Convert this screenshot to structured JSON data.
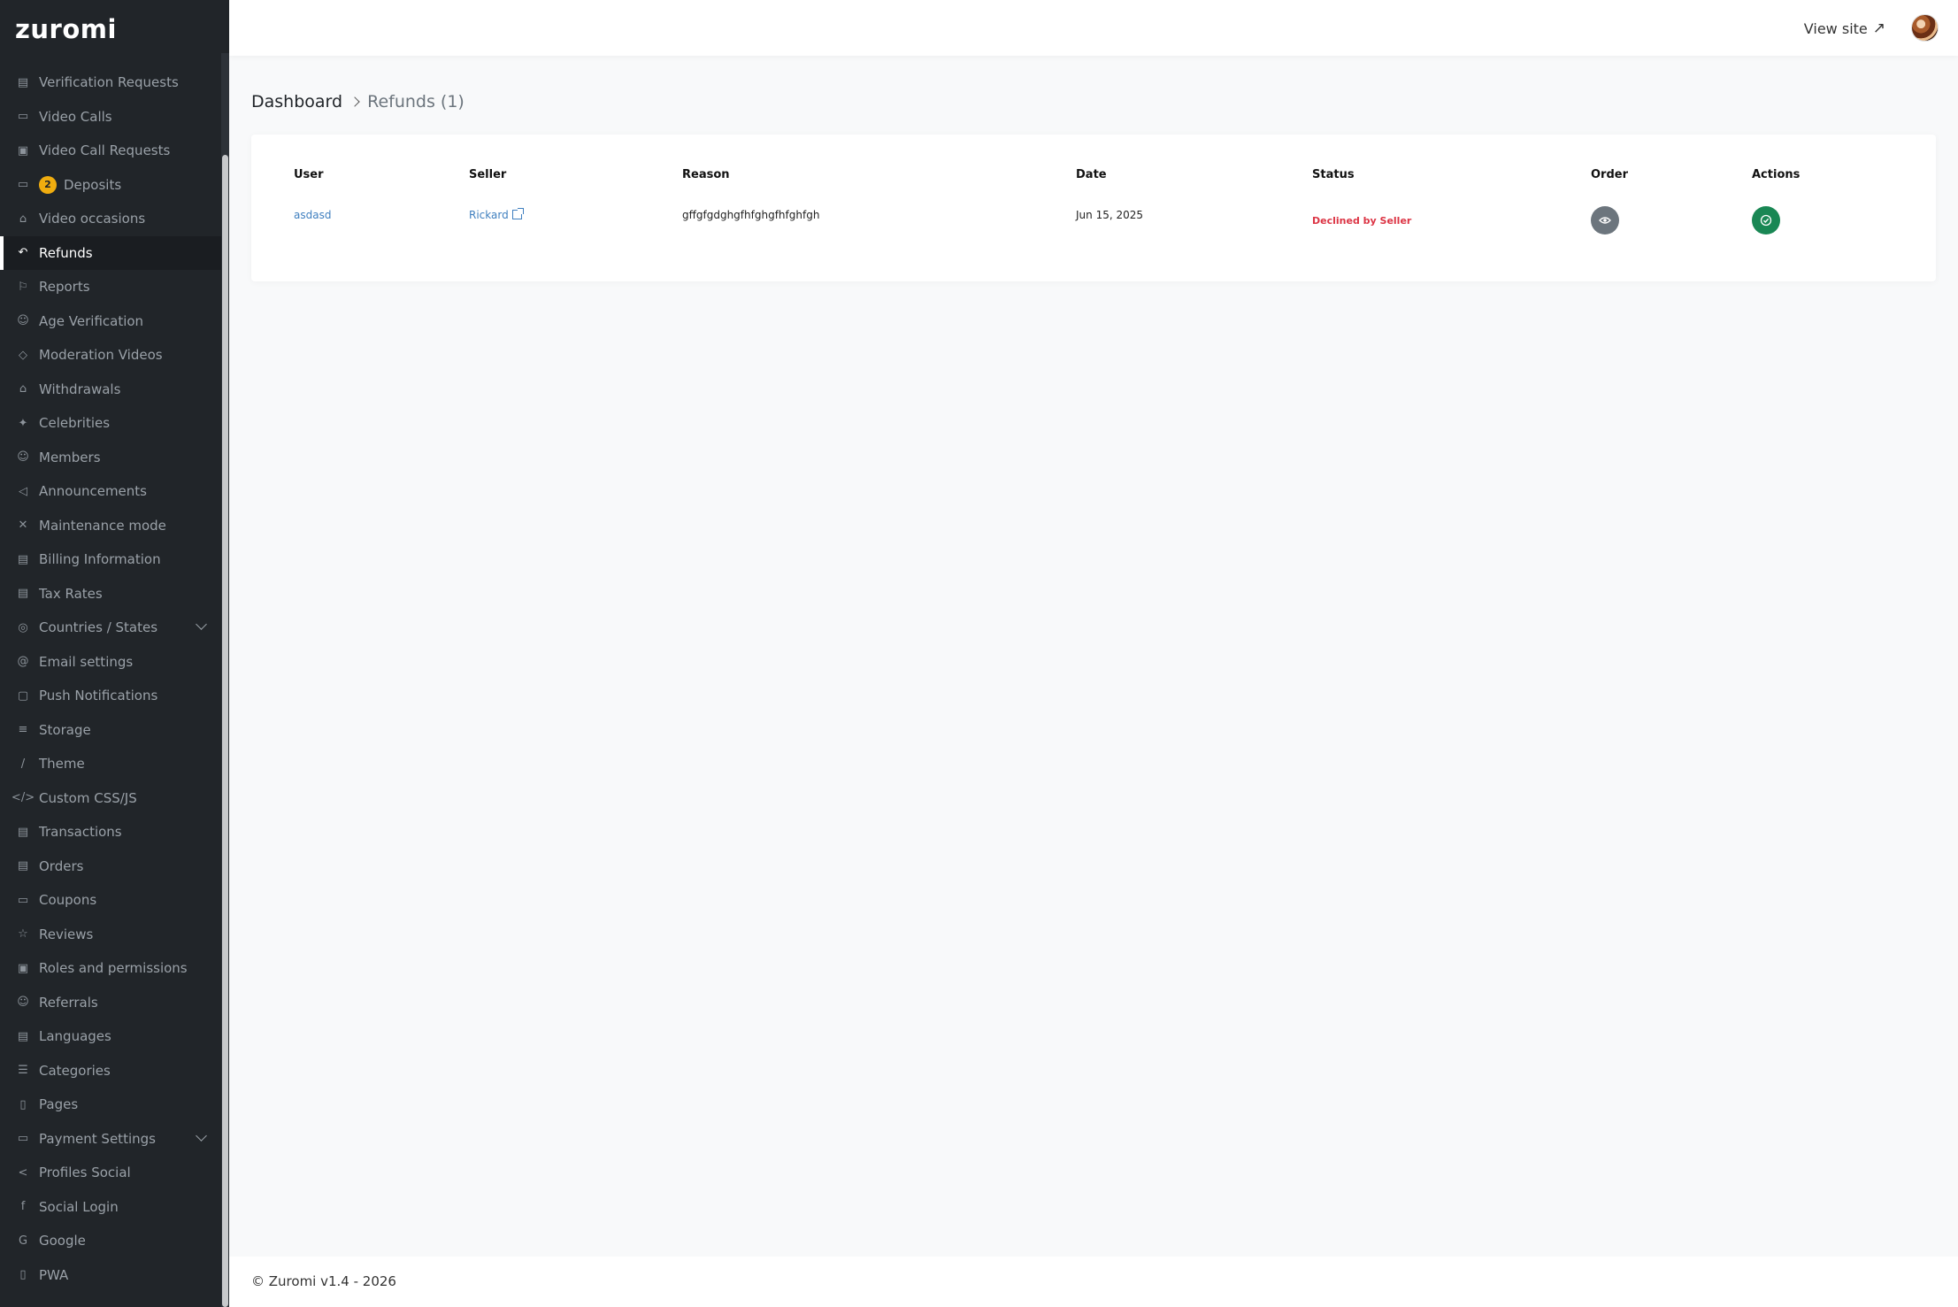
{
  "brand": {
    "name": "zuromi"
  },
  "header": {
    "view_site_label": "View site",
    "view_site_icon": "arrow-up-right-icon"
  },
  "sidebar": {
    "items": [
      {
        "label": "Verification Requests",
        "icon": "id-card-icon",
        "glyph": "▤"
      },
      {
        "label": "Video Calls",
        "icon": "video-camera-icon",
        "glyph": "▭"
      },
      {
        "label": "Video Call Requests",
        "icon": "video-request-icon",
        "glyph": "▣"
      },
      {
        "label": "Deposits",
        "icon": "cash-icon",
        "glyph": "▭",
        "badge": "2"
      },
      {
        "label": "Video occasions",
        "icon": "shop-icon",
        "glyph": "⌂"
      },
      {
        "label": "Refunds",
        "icon": "refund-icon",
        "glyph": "↶",
        "active": true
      },
      {
        "label": "Reports",
        "icon": "flag-icon",
        "glyph": "⚐"
      },
      {
        "label": "Age Verification",
        "icon": "person-badge-icon",
        "glyph": "☺"
      },
      {
        "label": "Moderation Videos",
        "icon": "shield-icon",
        "glyph": "◇"
      },
      {
        "label": "Withdrawals",
        "icon": "bank-icon",
        "glyph": "⌂"
      },
      {
        "label": "Celebrities",
        "icon": "stars-icon",
        "glyph": "✦"
      },
      {
        "label": "Members",
        "icon": "people-icon",
        "glyph": "☺"
      },
      {
        "label": "Announcements",
        "icon": "megaphone-icon",
        "glyph": "◁"
      },
      {
        "label": "Maintenance mode",
        "icon": "tools-icon",
        "glyph": "✕"
      },
      {
        "label": "Billing Information",
        "icon": "receipt-icon",
        "glyph": "▤"
      },
      {
        "label": "Tax Rates",
        "icon": "receipt-icon",
        "glyph": "▤"
      },
      {
        "label": "Countries / States",
        "icon": "globe-icon",
        "glyph": "◎",
        "expandable": true
      },
      {
        "label": "Email settings",
        "icon": "at-icon",
        "glyph": "@"
      },
      {
        "label": "Push Notifications",
        "icon": "app-indicator-icon",
        "glyph": "▢"
      },
      {
        "label": "Storage",
        "icon": "database-icon",
        "glyph": "≡"
      },
      {
        "label": "Theme",
        "icon": "brush-icon",
        "glyph": "/"
      },
      {
        "label": "Custom CSS/JS",
        "icon": "code-icon",
        "glyph": "</>"
      },
      {
        "label": "Transactions",
        "icon": "receipt-icon",
        "glyph": "▤"
      },
      {
        "label": "Orders",
        "icon": "receipt-icon",
        "glyph": "▤"
      },
      {
        "label": "Coupons",
        "icon": "ticket-icon",
        "glyph": "▭"
      },
      {
        "label": "Reviews",
        "icon": "star-icon",
        "glyph": "☆"
      },
      {
        "label": "Roles and permissions",
        "icon": "person-lock-icon",
        "glyph": "▣"
      },
      {
        "label": "Referrals",
        "icon": "person-plus-icon",
        "glyph": "☺"
      },
      {
        "label": "Languages",
        "icon": "translate-icon",
        "glyph": "▤"
      },
      {
        "label": "Categories",
        "icon": "list-icon",
        "glyph": "☰"
      },
      {
        "label": "Pages",
        "icon": "file-icon",
        "glyph": "▯"
      },
      {
        "label": "Payment Settings",
        "icon": "credit-card-icon",
        "glyph": "▭",
        "expandable": true
      },
      {
        "label": "Profiles Social",
        "icon": "share-icon",
        "glyph": "<"
      },
      {
        "label": "Social Login",
        "icon": "facebook-icon",
        "glyph": "f"
      },
      {
        "label": "Google",
        "icon": "google-icon",
        "glyph": "G"
      },
      {
        "label": "PWA",
        "icon": "phone-icon",
        "glyph": "▯"
      }
    ]
  },
  "breadcrumb": {
    "root": "Dashboard",
    "current": "Refunds (1)"
  },
  "table": {
    "headers": {
      "user": "User",
      "seller": "Seller",
      "reason": "Reason",
      "date": "Date",
      "status": "Status",
      "order": "Order",
      "actions": "Actions"
    },
    "rows": [
      {
        "user": "asdasd",
        "seller": "Rickard",
        "reason": "gffgfgdghgfhfghgfhfghfgh",
        "date": "Jun 15, 2025",
        "status": "Declined by Seller",
        "status_color": "#dc3545",
        "order_icon": "eye-icon",
        "action_icon": "check-circle-icon"
      }
    ]
  },
  "footer": {
    "text": "© Zuromi v1.4 - 2026"
  }
}
